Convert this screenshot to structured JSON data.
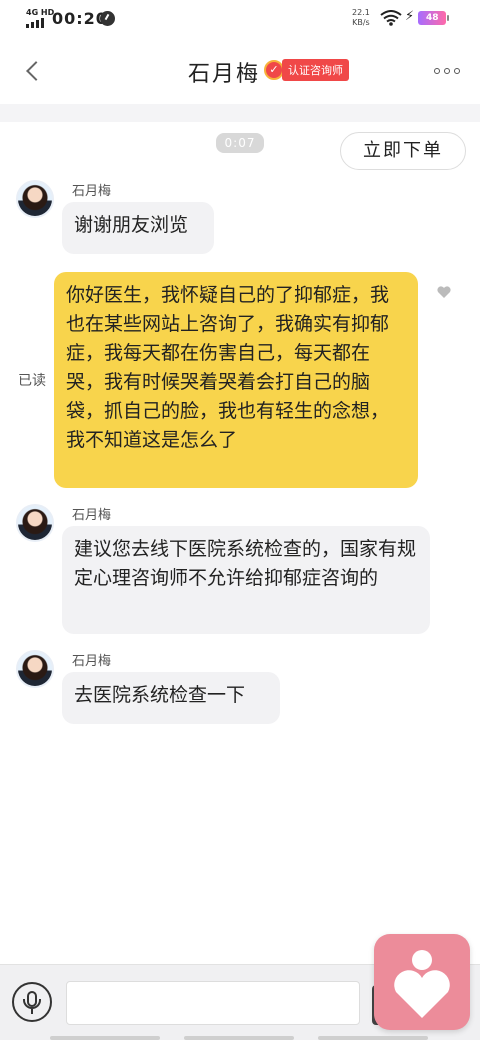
{
  "status_bar": {
    "network": "4G HD",
    "time": "00:20",
    "speed_value": "22.1",
    "speed_unit": "KB/s",
    "battery": "48"
  },
  "header": {
    "title": "石月梅",
    "badge": "认证咨询师"
  },
  "chat": {
    "timestamp": "0:07",
    "order_button": "立即下单",
    "read_status": "已读",
    "messages": [
      {
        "from": "counselor",
        "sender": "石月梅",
        "text": "谢谢朋友浏览"
      },
      {
        "from": "me",
        "text": "你好医生，我怀疑自己的了抑郁症，我也在某些网站上咨询了，我确实有抑郁症，我每天都在伤害自己，每天都在哭，我有时候哭着哭着会打自己的脑袋，抓自己的脸，我也有轻生的念想，我不知道这是怎么了"
      },
      {
        "from": "counselor",
        "sender": "石月梅",
        "text": "建议您去线下医院系统检查的，国家有规定心理咨询师不允许给抑郁症咨询的"
      },
      {
        "from": "counselor",
        "sender": "石月梅",
        "text": "去医院系统检查一下"
      }
    ]
  },
  "input": {
    "placeholder": "",
    "value": ""
  },
  "colors": {
    "my_bubble": "#f8d44c",
    "their_bubble": "#f2f2f4",
    "badge": "#f04848",
    "heart_button": "#ec8c9a"
  },
  "icons": [
    "back-icon",
    "verified-badge-icon",
    "more-icon",
    "like-icon",
    "mic-icon",
    "heart-icon"
  ]
}
